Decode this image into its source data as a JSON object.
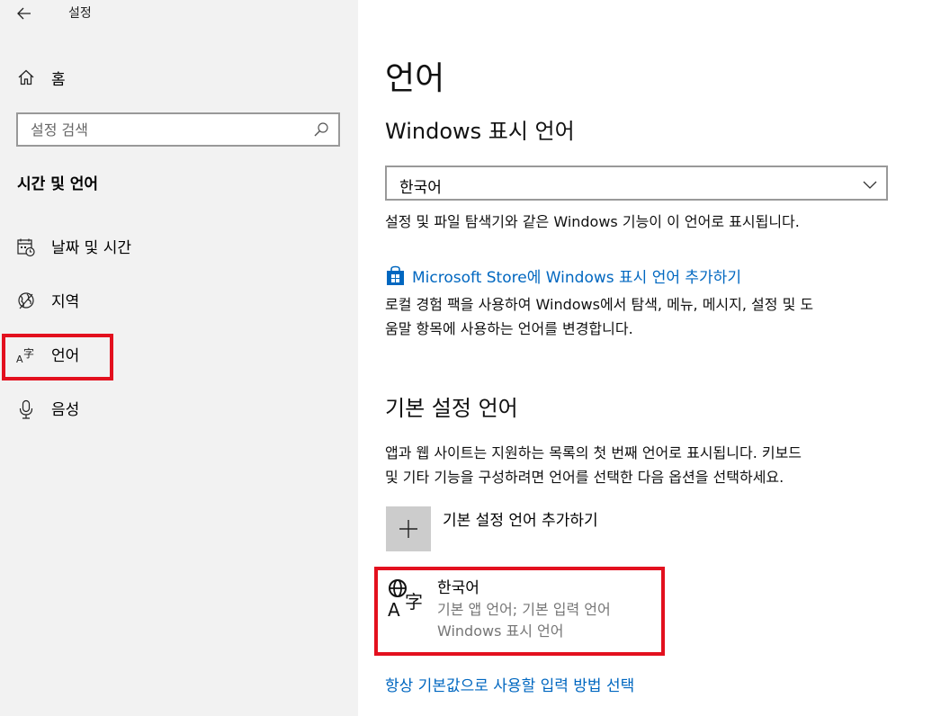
{
  "window": {
    "title": "설정"
  },
  "sidebar": {
    "home_label": "홈",
    "search_placeholder": "설정 검색",
    "section_title": "시간 및 언어",
    "items": [
      {
        "label": "날짜 및 시간",
        "icon": "calendar-clock-icon"
      },
      {
        "label": "지역",
        "icon": "globe-region-icon"
      },
      {
        "label": "언어",
        "icon": "language-icon",
        "selected": true
      },
      {
        "label": "음성",
        "icon": "microphone-icon"
      }
    ]
  },
  "main": {
    "title": "언어",
    "display_language": {
      "heading": "Windows 표시 언어",
      "selected": "한국어",
      "description": "설정 및 파일 탐색기와 같은 Windows 기능이 이 언어로 표시됩니다."
    },
    "store": {
      "link_label": "Microsoft Store에 Windows 표시 언어 추가하기",
      "description_line1": "로컬 경험 팩을 사용하여 Windows에서 탐색, 메뉴, 메시지, 설정 및 도",
      "description_line2": "움말 항목에 사용하는 언어를 변경합니다."
    },
    "preferred": {
      "heading": "기본 설정 언어",
      "description_line1": "앱과 웹 사이트는 지원하는 목록의 첫 번째 언어로 표시됩니다. 키보드",
      "description_line2": "및 기타 기능을 구성하려면 언어를 선택한 다음 옵션을 선택하세요.",
      "add_label": "기본 설정 언어 추가하기",
      "languages": [
        {
          "name": "한국어",
          "detail1": "기본 앱 언어; 기본 입력 언어",
          "detail2": "Windows 표시 언어"
        }
      ]
    },
    "bottom_link": "항상 기본값으로 사용할 입력 방법 선택"
  },
  "colors": {
    "accent": "#0067c0",
    "sidebar_bg": "#f2f2f2",
    "highlight": "#e3101e"
  }
}
